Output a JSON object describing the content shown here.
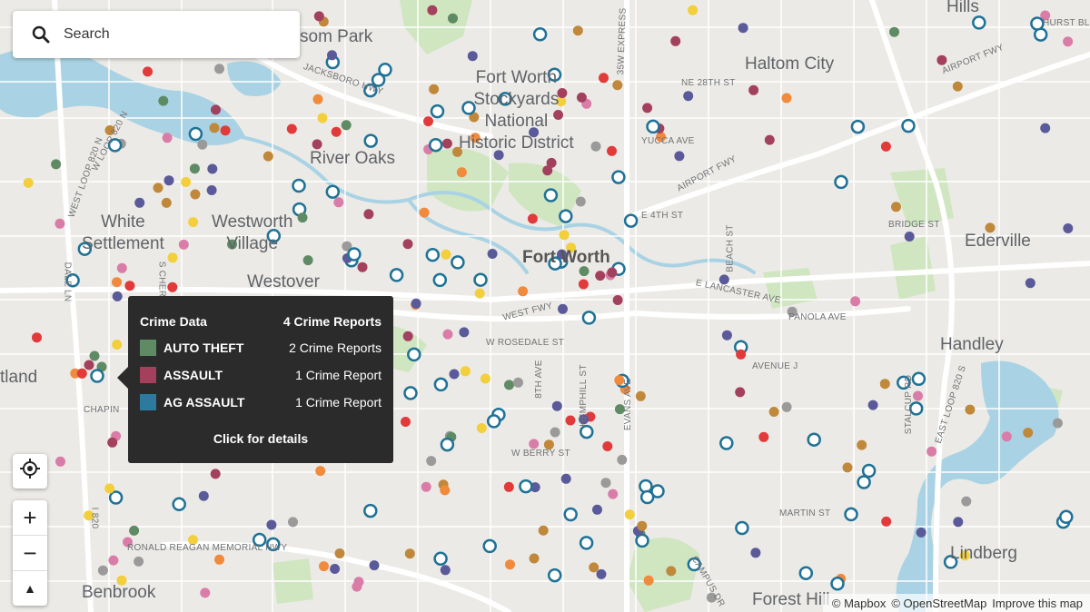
{
  "search": {
    "placeholder": "Search"
  },
  "places": [
    {
      "name": "Hills"
    },
    {
      "name": "Haltom City"
    },
    {
      "name": "River Oaks"
    },
    {
      "name": "Fort Worth\nStockyards\nNational\nHistoric District"
    },
    {
      "name": "White\nSettlement"
    },
    {
      "name": "Westworth\nVillage"
    },
    {
      "name": "Westover"
    },
    {
      "name": "Fort Worth"
    },
    {
      "name": "Ederville"
    },
    {
      "name": "Handley"
    },
    {
      "name": "Lindberg"
    },
    {
      "name": "Benbrook"
    },
    {
      "name": "Forest Hill"
    },
    {
      "name": "tland"
    },
    {
      "name": "som Park"
    }
  ],
  "streets": [
    "HURST BL",
    "AIRPORT FWY",
    "JACKSBORO HWY",
    "35W EXPRESS",
    "NE 28TH ST",
    "YUCCA AVE",
    "AIRPORT FWY",
    "E 4TH ST",
    "BRIDGE ST",
    "W LOOP 820 N",
    "WEST LOOP 820 N",
    "DALE LN",
    "S CHER",
    "WEST FWY",
    "W ROSEDALE ST",
    "E LANCASTER AVE",
    "PANOLA AVE",
    "AVENUE J",
    "8TH AVE",
    "HEMPHILL ST",
    "EVANS AVE",
    "BEACH ST",
    "STALCUP RD",
    "EAST LOOP 820 S",
    "CHAPIN",
    "W BERRY ST",
    "MARTIN ST",
    "RONALD REAGAN MEMORIAL HWY",
    "I 820",
    "CAMPUS DR",
    "OD"
  ],
  "tooltip": {
    "title": "Crime Data",
    "total": "4 Crime Reports",
    "rows": [
      {
        "name": "AUTO THEFT",
        "count": "2 Crime Reports",
        "color": "#5e8a64"
      },
      {
        "name": "ASSAULT",
        "count": "1 Crime Report",
        "color": "#a3405e"
      },
      {
        "name": "AG ASSAULT",
        "count": "1 Crime Report",
        "color": "#2c7a9e"
      }
    ],
    "footer": "Click for details"
  },
  "controls": {
    "zoom_in": "+",
    "zoom_out": "−",
    "north": "▲"
  },
  "attribution": {
    "mapbox": "© Mapbox",
    "osm": "© OpenStreetMap",
    "improve": "Improve this map"
  },
  "colors": {
    "water": "#a9d3e4",
    "park": "#cfe6c0",
    "road": "#ffffff",
    "auto_theft": "#5e8a64",
    "assault": "#a3405e",
    "ag_assault": "#2c7a9e",
    "marker_red": "#e23a3a",
    "marker_orange": "#f08a3c",
    "marker_yellow": "#f2cf3b",
    "marker_purple": "#5a5a9a",
    "marker_pink": "#d97da8",
    "marker_gray": "#9a9a9a",
    "marker_brown": "#c0883a",
    "marker_ring": "#1f7296"
  },
  "icons": [
    "search-icon",
    "locate-icon",
    "zoom-in-icon",
    "zoom-out-icon",
    "compass-icon"
  ]
}
